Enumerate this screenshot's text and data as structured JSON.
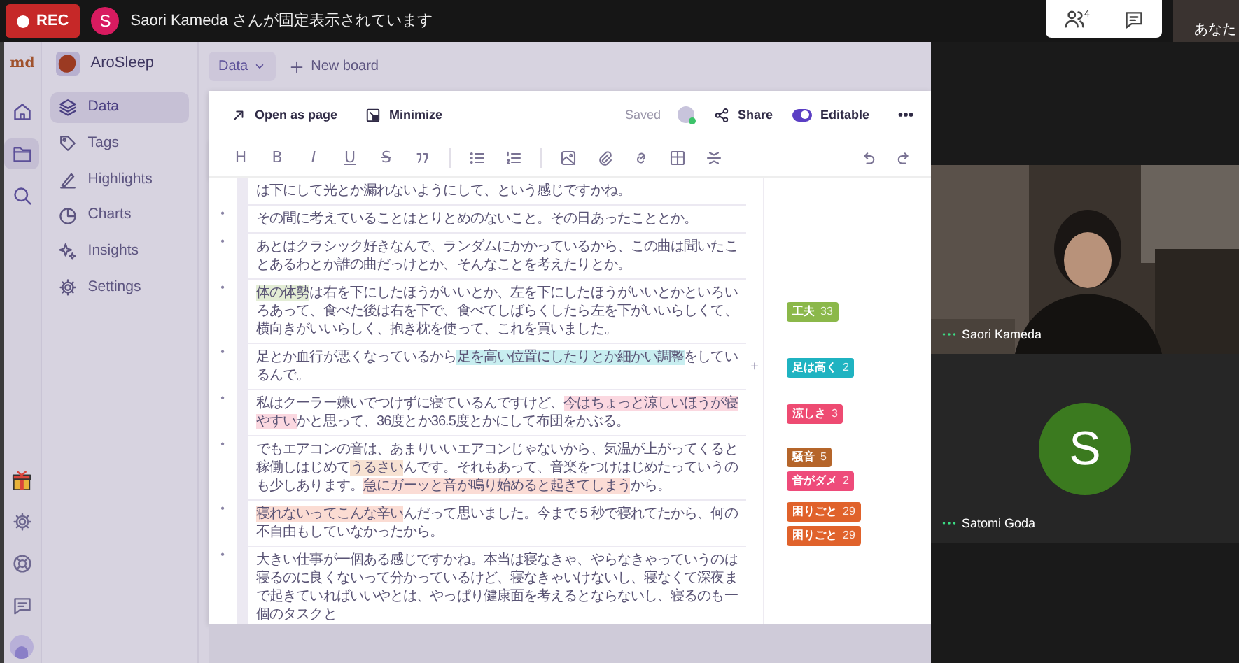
{
  "meeting_bar": {
    "rec": "REC",
    "presenter_initial": "S",
    "notice": "Saori Kameda さんが固定表示されています",
    "participants_count": "4",
    "self_view": "あなた"
  },
  "app": {
    "logo": "md",
    "project": "AroSleep",
    "rail": [
      {
        "selected": false
      },
      {
        "selected": true
      },
      {
        "selected": false
      }
    ],
    "nav": [
      {
        "label": "Data",
        "selected": true
      },
      {
        "label": "Tags",
        "selected": false
      },
      {
        "label": "Highlights",
        "selected": false
      },
      {
        "label": "Charts",
        "selected": false
      },
      {
        "label": "Insights",
        "selected": false
      },
      {
        "label": "Settings",
        "selected": false
      }
    ]
  },
  "board": {
    "view": "Data",
    "new_board": "New board"
  },
  "panel": {
    "actions": [
      "Open as page",
      "Minimize"
    ],
    "status": "Saved",
    "share": "Share",
    "editable": {
      "label": "Editable",
      "on": true
    },
    "format_buttons": [
      {
        "label": "H",
        "kind": "heading"
      },
      {
        "label": "B",
        "kind": "bold"
      },
      {
        "label": "I",
        "kind": "italic"
      },
      {
        "label": "U",
        "kind": "underline"
      },
      {
        "label": "S",
        "kind": "strike"
      }
    ],
    "rows": [
      {
        "segments": [
          {
            "text": "は下にして光とか漏れないようにして、という感じですかね。"
          }
        ],
        "tags": []
      },
      {
        "bullet": "•",
        "segments": [
          {
            "text": "その間に考えていることはとりとめのないこと。その日あったこととか。"
          }
        ],
        "tags": []
      },
      {
        "bullet": "•",
        "segments": [
          {
            "text": "あとはクラシック好きなんで、ランダムにかかっているから、この曲は聞いたことあるわとか誰の曲だっけとか、そんなことを考えたりとか。"
          }
        ],
        "tags": []
      },
      {
        "bullet": "•",
        "segments": [
          {
            "text": "体の体勢",
            "color": "#e3edd5"
          },
          {
            "text": "は右を下にしたほうがいいとか、左を下にしたほうがいいとかといろいろあって、食べた後は右を下で、食べてしばらくしたら左を下がいいらしくて、横向きがいいらしく、抱き枕を使って、これを買いました。"
          }
        ],
        "tags": [
          {
            "label": "工夫",
            "count": "33",
            "color": "#8bb84a"
          }
        ]
      },
      {
        "bullet": "•",
        "segments": [
          {
            "text": "足とか血行が悪くなっているから"
          },
          {
            "text": "足を高い位置にしたりとか細かい調整",
            "color": "#c8eef0"
          },
          {
            "text": "をしているんで。"
          }
        ],
        "tags": [
          {
            "label": "足は高く",
            "count": "2",
            "color": "#1fb3c1"
          }
        ],
        "add": "+"
      },
      {
        "bullet": "•",
        "segments": [
          {
            "text": "私はクーラー嫌いでつけずに寝ているんですけど、"
          },
          {
            "text": "今はちょっと涼しいほうが寝やすい",
            "color": "#fbd8e0"
          },
          {
            "text": "かと思って、36度とか36.5度とかにして布団をかぶる。"
          }
        ],
        "tags": [
          {
            "label": "涼しさ",
            "count": "3",
            "color": "#ee4b72"
          }
        ]
      },
      {
        "bullet": "•",
        "segments": [
          {
            "text": "でもエアコンの音は、あまりいいエアコンじゃないから、気温が上がってくると稼働しはじめて"
          },
          {
            "text": "うるさい",
            "color": "#f7e2d2"
          },
          {
            "text": "んです。それもあって、音楽をつけはじめたっていうのも少しあります。"
          },
          {
            "text": "急にガーッと音が鳴り始めると起きてしまう",
            "color": "#fbdcd5"
          },
          {
            "text": "から。"
          }
        ],
        "tags": [
          {
            "label": "騒音",
            "count": "5",
            "color": "#b5652a"
          },
          {
            "label": "音がダメ",
            "count": "2",
            "color": "#ee4b7a"
          }
        ]
      },
      {
        "bullet": "•",
        "segments": [
          {
            "text": "寝れないってこんな辛い",
            "color": "#fbdcd3"
          },
          {
            "text": "んだって思いました。今まで５秒で寝れてたから、何の不自由もしていなかったから。"
          }
        ],
        "tags": [
          {
            "label": "困りごと",
            "count": "29",
            "color": "#e0622b"
          },
          {
            "label": "困りごと",
            "count": "29",
            "color": "#e0622b"
          }
        ]
      },
      {
        "bullet": "•",
        "segments": [
          {
            "text": "大きい仕事が一個ある感じですかね。本当は寝なきゃ、やらなきゃっていうのは寝るのに良くないって分かっているけど、寝なきゃいけないし、寝なくて深夜まで起きていればいいやとは、やっぱり健康面を考えるとならないし、寝るのも一個のタスクと"
          }
        ],
        "tags": []
      }
    ]
  },
  "participants": [
    {
      "kind": "video",
      "name": "Saori Kameda"
    },
    {
      "kind": "avatar",
      "name": "Satomi Goda",
      "initial": "S",
      "color": "#3b7a1f"
    }
  ]
}
